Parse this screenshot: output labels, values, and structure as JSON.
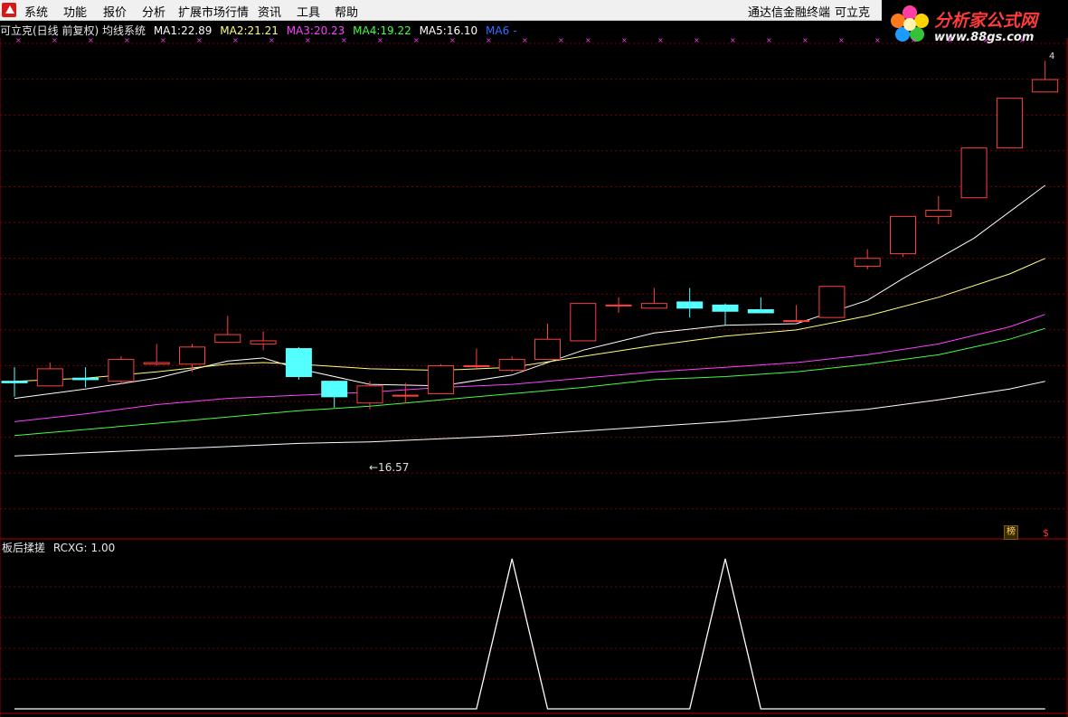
{
  "menu": {
    "items": [
      "系统",
      "功能",
      "报价",
      "分析",
      "扩展市场行情",
      "资讯",
      "工具",
      "帮助"
    ],
    "app_name": "通达信金融终端",
    "stock_name": "可立克"
  },
  "brand": {
    "name": "分析家公式网",
    "url": "www.88gs.com"
  },
  "main_info": {
    "title": "可立克(日线 前复权) 均线系统",
    "ma": [
      {
        "label": "MA1:",
        "value": "22.89",
        "color": "#ffffff"
      },
      {
        "label": "MA2:",
        "value": "21.21",
        "color": "#ffff7a"
      },
      {
        "label": "MA3:",
        "value": "20.23",
        "color": "#ff40ff"
      },
      {
        "label": "MA4:",
        "value": "19.22",
        "color": "#40ff40"
      },
      {
        "label": "MA5:",
        "value": "16.10",
        "color": "#ffffff"
      },
      {
        "label": "MA6",
        "value": "-",
        "color": "#3a6bff"
      }
    ]
  },
  "indicator_info": {
    "name": "板后揉搓",
    "label": "RCXG:",
    "value": "1.00"
  },
  "annotations": {
    "low_price": "←16.57",
    "tag_bang": "榜",
    "tag_dollar": "$",
    "edge_value": "4"
  },
  "colors": {
    "up": "#ff4040",
    "down": "#54ffff",
    "grid": "#7a0000"
  },
  "chart_data": [
    {
      "type": "candlestick",
      "price_range": [
        14.5,
        28.6
      ],
      "candles": [
        {
          "o": 18.9,
          "c": 18.85,
          "h": 19.35,
          "l": 18.4
        },
        {
          "o": 18.75,
          "c": 19.3,
          "h": 19.5,
          "l": 18.75
        },
        {
          "o": 19.0,
          "c": 18.95,
          "h": 19.35,
          "l": 18.7
        },
        {
          "o": 18.9,
          "c": 19.6,
          "h": 19.7,
          "l": 18.8
        },
        {
          "o": 19.45,
          "c": 19.5,
          "h": 20.1,
          "l": 19.4
        },
        {
          "o": 19.45,
          "c": 20.0,
          "h": 20.1,
          "l": 19.2
        },
        {
          "o": 20.15,
          "c": 20.4,
          "h": 21.0,
          "l": 20.15
        },
        {
          "o": 20.1,
          "c": 20.2,
          "h": 20.5,
          "l": 19.9
        },
        {
          "o": 19.95,
          "c": 19.05,
          "h": 20.0,
          "l": 18.95
        },
        {
          "o": 18.9,
          "c": 18.4,
          "h": 18.9,
          "l": 18.05
        },
        {
          "o": 18.2,
          "c": 18.75,
          "h": 18.9,
          "l": 18.0
        },
        {
          "o": 18.45,
          "c": 18.45,
          "h": 18.85,
          "l": 18.2
        },
        {
          "o": 18.5,
          "c": 19.4,
          "h": 19.45,
          "l": 18.5
        },
        {
          "o": 19.4,
          "c": 19.4,
          "h": 19.95,
          "l": 19.3
        },
        {
          "o": 19.25,
          "c": 19.6,
          "h": 19.7,
          "l": 19.2
        },
        {
          "o": 19.6,
          "c": 20.25,
          "h": 20.75,
          "l": 19.6
        },
        {
          "o": 20.2,
          "c": 21.4,
          "h": 21.4,
          "l": 20.2
        },
        {
          "o": 21.35,
          "c": 21.35,
          "h": 21.6,
          "l": 21.1
        },
        {
          "o": 21.25,
          "c": 21.4,
          "h": 21.9,
          "l": 21.25
        },
        {
          "o": 21.45,
          "c": 21.25,
          "h": 21.9,
          "l": 20.95
        },
        {
          "o": 21.35,
          "c": 21.15,
          "h": 21.4,
          "l": 20.7
        },
        {
          "o": 21.2,
          "c": 21.1,
          "h": 21.6,
          "l": 21.1
        },
        {
          "o": 20.85,
          "c": 20.85,
          "h": 21.35,
          "l": 20.85
        },
        {
          "o": 20.95,
          "c": 21.95,
          "h": 21.95,
          "l": 20.95
        },
        {
          "o": 22.6,
          "c": 22.85,
          "h": 23.15,
          "l": 22.5
        },
        {
          "o": 23.0,
          "c": 24.2,
          "h": 24.2,
          "l": 22.9
        },
        {
          "o": 24.2,
          "c": 24.4,
          "h": 24.85,
          "l": 23.95
        },
        {
          "o": 24.8,
          "c": 26.4,
          "h": 26.4,
          "l": 24.8
        },
        {
          "o": 26.4,
          "c": 28.0,
          "h": 28.0,
          "l": 26.4
        },
        {
          "o": 28.2,
          "c": 28.6,
          "h": 29.2,
          "l": 28.2
        }
      ],
      "ma_series": [
        {
          "name": "MA1",
          "color": "#ffffff",
          "points": [
            [
              0,
              18.35
            ],
            [
              2,
              18.65
            ],
            [
              4,
              19.0
            ],
            [
              6,
              19.55
            ],
            [
              7,
              19.65
            ],
            [
              8,
              19.3
            ],
            [
              10,
              18.8
            ],
            [
              12,
              18.75
            ],
            [
              14,
              19.1
            ],
            [
              16,
              19.9
            ],
            [
              18,
              20.45
            ],
            [
              20,
              20.7
            ],
            [
              22,
              20.75
            ],
            [
              24,
              21.5
            ],
            [
              25,
              22.2
            ],
            [
              27,
              23.5
            ],
            [
              29,
              25.2
            ]
          ]
        },
        {
          "name": "MA2",
          "color": "#ffff7a",
          "points": [
            [
              0,
              18.9
            ],
            [
              2,
              19.0
            ],
            [
              4,
              19.2
            ],
            [
              6,
              19.45
            ],
            [
              7,
              19.5
            ],
            [
              8,
              19.45
            ],
            [
              10,
              19.3
            ],
            [
              12,
              19.25
            ],
            [
              14,
              19.35
            ],
            [
              16,
              19.7
            ],
            [
              18,
              20.05
            ],
            [
              20,
              20.35
            ],
            [
              22,
              20.55
            ],
            [
              24,
              21.0
            ],
            [
              26,
              21.6
            ],
            [
              28,
              22.35
            ],
            [
              29,
              22.85
            ]
          ]
        },
        {
          "name": "MA3",
          "color": "#ff40ff",
          "points": [
            [
              0,
              17.6
            ],
            [
              2,
              17.85
            ],
            [
              4,
              18.15
            ],
            [
              6,
              18.35
            ],
            [
              8,
              18.45
            ],
            [
              10,
              18.55
            ],
            [
              12,
              18.7
            ],
            [
              14,
              18.8
            ],
            [
              16,
              19.0
            ],
            [
              18,
              19.2
            ],
            [
              20,
              19.35
            ],
            [
              22,
              19.5
            ],
            [
              24,
              19.75
            ],
            [
              26,
              20.1
            ],
            [
              28,
              20.65
            ],
            [
              29,
              21.05
            ]
          ]
        },
        {
          "name": "MA4",
          "color": "#40ff40",
          "points": [
            [
              0,
              17.15
            ],
            [
              2,
              17.35
            ],
            [
              4,
              17.55
            ],
            [
              6,
              17.75
            ],
            [
              8,
              17.95
            ],
            [
              10,
              18.1
            ],
            [
              12,
              18.3
            ],
            [
              14,
              18.5
            ],
            [
              16,
              18.7
            ],
            [
              18,
              18.95
            ],
            [
              20,
              19.05
            ],
            [
              22,
              19.2
            ],
            [
              24,
              19.45
            ],
            [
              26,
              19.75
            ],
            [
              28,
              20.25
            ],
            [
              29,
              20.6
            ]
          ]
        },
        {
          "name": "MA5",
          "color": "#ffffff",
          "points": [
            [
              0,
              16.5
            ],
            [
              2,
              16.6
            ],
            [
              4,
              16.7
            ],
            [
              6,
              16.8
            ],
            [
              8,
              16.9
            ],
            [
              10,
              16.95
            ],
            [
              12,
              17.05
            ],
            [
              14,
              17.15
            ],
            [
              16,
              17.3
            ],
            [
              18,
              17.45
            ],
            [
              20,
              17.6
            ],
            [
              22,
              17.8
            ],
            [
              24,
              18.0
            ],
            [
              26,
              18.3
            ],
            [
              28,
              18.65
            ],
            [
              29,
              18.9
            ]
          ]
        }
      ]
    },
    {
      "type": "line",
      "name": "RCXG",
      "ylim": [
        0,
        1
      ],
      "points": [
        [
          0,
          0
        ],
        [
          13,
          0
        ],
        [
          14,
          1
        ],
        [
          15,
          0
        ],
        [
          19,
          0
        ],
        [
          20,
          1
        ],
        [
          21,
          0
        ],
        [
          29,
          0
        ]
      ]
    }
  ]
}
